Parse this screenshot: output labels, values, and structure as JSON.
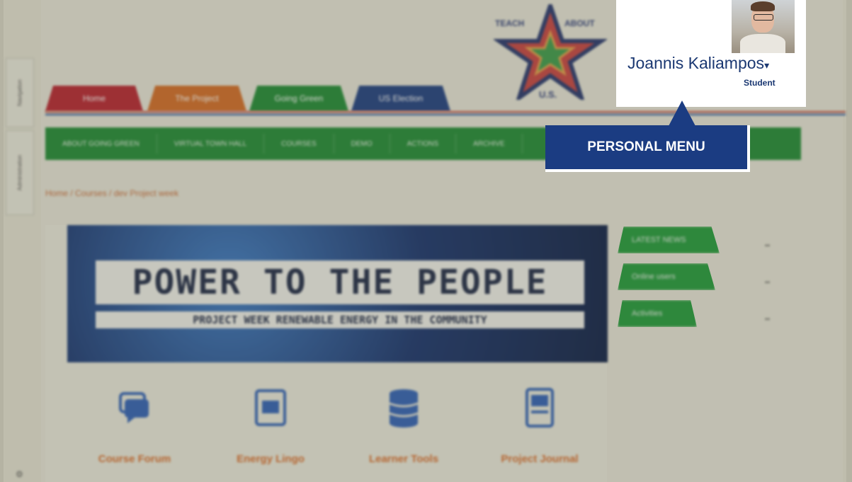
{
  "dock": {
    "navigation": "Navigation",
    "administration": "Administration"
  },
  "logo": {
    "top_left": "TEACH",
    "top_right": "ABOUT",
    "bottom": "U.S."
  },
  "tabs": [
    {
      "label": "Home",
      "color": "#b8202f"
    },
    {
      "label": "The Project",
      "color": "#d46a24"
    },
    {
      "label": "Going Green",
      "color": "#1d8a34"
    },
    {
      "label": "US Election",
      "color": "#1b3c82"
    }
  ],
  "nav": [
    "ABOUT GOING GREEN",
    "VIRTUAL TOWN HALL",
    "COURSES",
    "DEMO",
    "ACTIONS",
    "ARCHIVE"
  ],
  "breadcrumb": "Home / Courses / dev Project week",
  "banner": {
    "title": "POWER TO THE PEOPLE",
    "subtitle": "PROJECT WEEK RENEWABLE ENERGY IN THE COMMUNITY"
  },
  "activities": [
    {
      "label": "Course Forum",
      "icon": "forum-icon"
    },
    {
      "label": "Energy Lingo",
      "icon": "glossary-icon"
    },
    {
      "label": "Learner Tools",
      "icon": "database-icon"
    },
    {
      "label": "Project Journal",
      "icon": "journal-icon"
    }
  ],
  "blocks": [
    "LATEST NEWS",
    "Online users",
    "Activities"
  ],
  "user": {
    "name": "Joannis Kaliampos",
    "role": "Student"
  },
  "callout": "PERSONAL MENU",
  "colors": {
    "brand_blue": "#1b3c82",
    "nav_green": "#1d8a34",
    "accent_orange": "#d96a2a"
  }
}
